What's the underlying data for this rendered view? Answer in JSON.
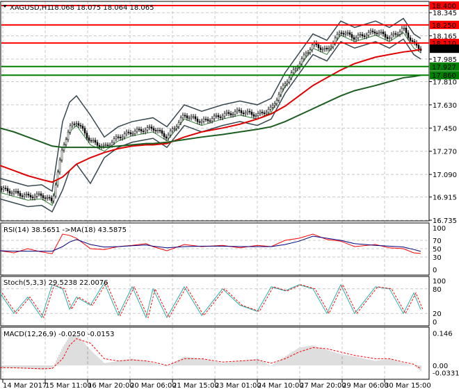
{
  "header": {
    "symbol": "XAGUSD,H1",
    "ohlc": "18.068 18.075 18.064 18.065"
  },
  "price_axis": [
    "18.345",
    "18.165",
    "17.985",
    "17.810",
    "17.630",
    "17.450",
    "17.270",
    "17.090",
    "16.915",
    "16.735"
  ],
  "levels": [
    {
      "value": "18.400",
      "color": "#ff0000"
    },
    {
      "value": "18.250",
      "color": "#ff0000"
    },
    {
      "value": "18.110",
      "color": "#ff0000"
    },
    {
      "value": "17.927",
      "color": "#008000"
    },
    {
      "value": "17.860",
      "color": "#008000"
    }
  ],
  "current_price": "18.065",
  "time_axis": [
    "14 Mar 2017",
    "15 Mar 11:00",
    "16 Mar 20:00",
    "20 Mar 06:00",
    "21 Mar 15:00",
    "23 Mar 01:00",
    "24 Mar 10:00",
    "27 Mar 20:00",
    "29 Mar 06:00",
    "30 Mar 15:00"
  ],
  "rsi": {
    "label": "RSI(14) 38.5651  ->MA(18) 43.5875",
    "axis": [
      "100",
      "70",
      "50",
      "30",
      "0"
    ]
  },
  "stoch": {
    "label": "Stoch(5,3,3) 29.5238 22.0076",
    "axis": [
      "100",
      "80",
      "20",
      "0"
    ]
  },
  "macd": {
    "label": "MACD(12,26,9) -0.0250 -0.0153",
    "axis": [
      "0.146",
      "0.00",
      "-0.0331"
    ]
  },
  "chart_data": {
    "type": "line",
    "title": "XAGUSD,H1",
    "ylim": [
      16.735,
      18.4
    ],
    "x": [
      0,
      20,
      40,
      60,
      75,
      90,
      100,
      110,
      130,
      150,
      170,
      190,
      210,
      220,
      240,
      265,
      290,
      320,
      345,
      370,
      390,
      410,
      430,
      450,
      470,
      490,
      510,
      540,
      560,
      580,
      595,
      605
    ],
    "close": [
      16.98,
      16.95,
      16.92,
      16.93,
      16.88,
      17.3,
      17.45,
      17.5,
      17.35,
      17.3,
      17.38,
      17.42,
      17.44,
      17.45,
      17.38,
      17.55,
      17.5,
      17.55,
      17.58,
      17.55,
      17.6,
      17.8,
      17.95,
      18.1,
      18.05,
      18.2,
      18.15,
      18.2,
      18.15,
      18.22,
      18.1,
      18.065
    ],
    "ma_red": [
      17.16,
      17.12,
      17.08,
      17.05,
      17.03,
      17.07,
      17.12,
      17.17,
      17.22,
      17.26,
      17.29,
      17.31,
      17.32,
      17.32,
      17.33,
      17.38,
      17.42,
      17.45,
      17.48,
      17.52,
      17.56,
      17.62,
      17.7,
      17.78,
      17.84,
      17.9,
      17.95,
      18.0,
      18.02,
      18.04,
      18.05,
      18.06
    ],
    "ma_green": [
      17.45,
      17.42,
      17.38,
      17.34,
      17.31,
      17.3,
      17.3,
      17.3,
      17.3,
      17.3,
      17.31,
      17.32,
      17.33,
      17.33,
      17.34,
      17.36,
      17.38,
      17.4,
      17.42,
      17.44,
      17.46,
      17.5,
      17.55,
      17.6,
      17.65,
      17.7,
      17.74,
      17.78,
      17.81,
      17.84,
      17.85,
      17.86
    ],
    "rsi": [
      45,
      40,
      50,
      42,
      38,
      85,
      82,
      75,
      50,
      48,
      55,
      58,
      62,
      55,
      45,
      60,
      55,
      58,
      52,
      58,
      55,
      70,
      75,
      85,
      72,
      68,
      55,
      60,
      52,
      50,
      40,
      38.6
    ],
    "rsi_ma": [
      45,
      44,
      44,
      44,
      44,
      55,
      66,
      72,
      60,
      54,
      55,
      57,
      59,
      56,
      52,
      55,
      56,
      56,
      55,
      55,
      55,
      60,
      68,
      80,
      75,
      70,
      62,
      58,
      56,
      54,
      48,
      43.6
    ],
    "stoch": [
      70,
      20,
      60,
      10,
      90,
      80,
      30,
      60,
      40,
      95,
      15,
      85,
      10,
      80,
      10,
      85,
      15,
      80,
      40,
      25,
      85,
      75,
      90,
      80,
      20,
      90,
      20,
      85,
      80,
      20,
      70,
      29.5
    ],
    "macd": [
      -0.01,
      -0.012,
      -0.015,
      -0.02,
      -0.015,
      0.08,
      0.13,
      0.14,
      0.07,
      0.01,
      0.02,
      0.03,
      0.02,
      0.01,
      -0.005,
      0.04,
      0.03,
      0.01,
      0.02,
      0.03,
      0.0,
      0.04,
      0.08,
      0.09,
      0.07,
      0.05,
      0.04,
      0.02,
      0.03,
      0.01,
      0.0,
      -0.025
    ],
    "macd_signal": [
      -0.01,
      -0.011,
      -0.013,
      -0.015,
      -0.014,
      0.03,
      0.09,
      0.12,
      0.1,
      0.03,
      0.02,
      0.025,
      0.02,
      0.015,
      0.0,
      0.03,
      0.03,
      0.015,
      0.02,
      0.025,
      0.01,
      0.03,
      0.06,
      0.08,
      0.075,
      0.06,
      0.045,
      0.03,
      0.03,
      0.015,
      0.005,
      -0.015
    ]
  }
}
